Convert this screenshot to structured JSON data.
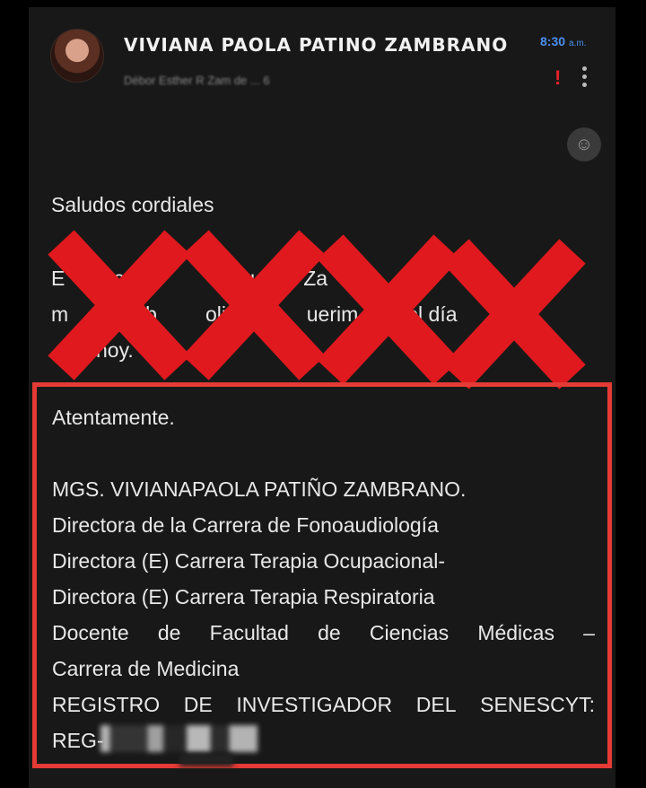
{
  "header": {
    "sender": "VIVIANA PAOLA PATINO ZAMBRANO",
    "recipients": "Débor  Esther R  Zam  de ...  6",
    "time": "8:30",
    "time_suffix": "a.m.",
    "priority": "!"
  },
  "icons": {
    "avatar": "avatar-photo",
    "priority": "exclamation-icon",
    "menu": "more-vert-icon",
    "emoji": "emoji-icon"
  },
  "body": {
    "greeting": "Saludos cordiales",
    "obscured_line1": [
      "E",
      "es",
      "",
      "pu",
      "Za"
    ],
    "obscured_line2": [
      "m",
      "en b",
      "olicitu",
      "uerim",
      "el día"
    ],
    "obscured_line3": [
      "hoy."
    ]
  },
  "signature": {
    "closing": "Atentamente.",
    "name": "MGS. VIVIANAPAOLA PATIÑO ZAMBRANO.",
    "title1": "Directora de la Carrera de Fonoaudiología",
    "title2": "Directora (E) Carrera Terapia Ocupacional-",
    "title3": "Directora (E) Carrera Terapia Respiratoria",
    "title4_words": [
      "Docente",
      "de",
      "Facultad",
      "de",
      "Ciencias",
      "Médicas",
      "–"
    ],
    "title5": "Carrera de Medicina",
    "registry_words": [
      "REGISTRO",
      "DE",
      "INVESTIGADOR",
      "DEL",
      "SENESCYT:"
    ],
    "reg_prefix": "REG-"
  },
  "colors": {
    "background": "#000000",
    "panel": "#181818",
    "accent_blue": "#4a8ff0",
    "x_red": "#e0191e",
    "box_red": "#e53a35"
  }
}
